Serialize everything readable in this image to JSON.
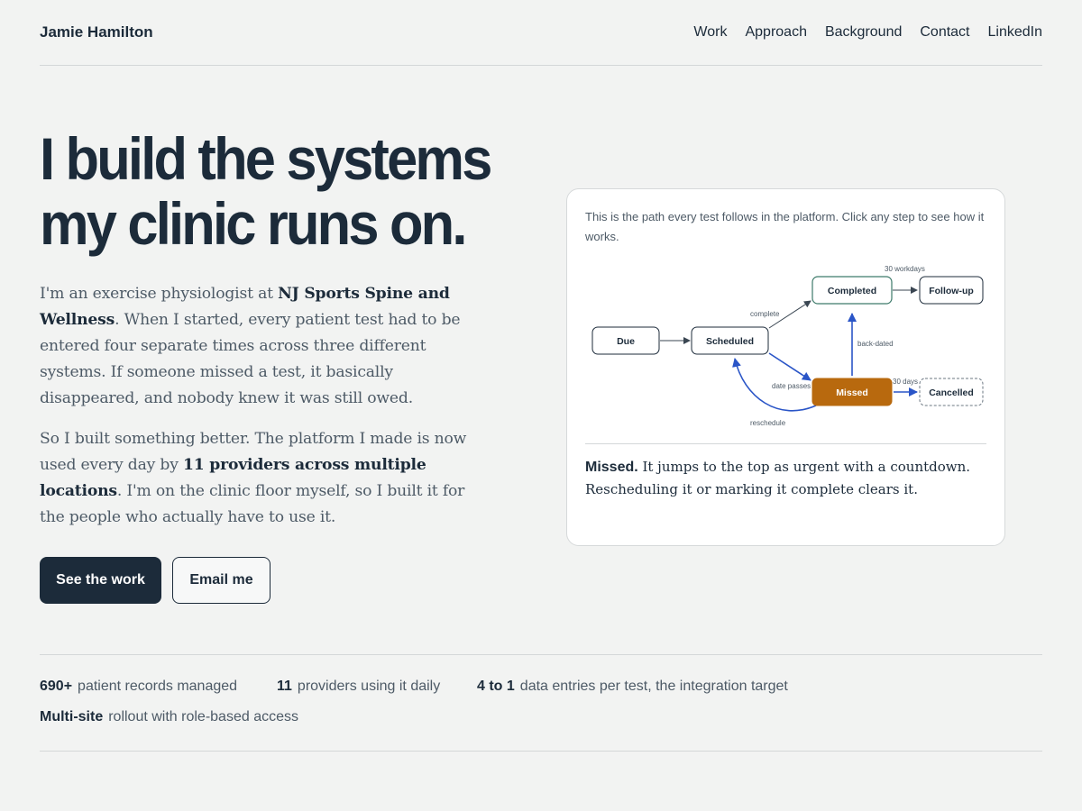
{
  "header": {
    "brand": "Jamie Hamilton",
    "nav": [
      "Work",
      "Approach",
      "Background",
      "Contact",
      "LinkedIn"
    ]
  },
  "hero": {
    "headline_line1": "I build the systems",
    "headline_line2": "my clinic runs on.",
    "p1_a": "I'm an exercise physiologist at ",
    "p1_strong": "NJ Sports Spine and Wellness",
    "p1_b": ". When I started, every patient test had to be entered four separate times across three different systems. If someone missed a test, it basically disappeared, and nobody knew it was still owed.",
    "p2_a": "So I built something better. The platform I made is now used every day by ",
    "p2_strong": "11 providers across multiple locations",
    "p2_b": ". I'm on the clinic floor myself, so I built it for the people who actually have to use it.",
    "primary_button": "See the work",
    "secondary_button": "Email me"
  },
  "card": {
    "intro": "This is the path every test follows in the platform. Click any step to see how it works.",
    "nodes": {
      "due": "Due",
      "scheduled": "Scheduled",
      "completed": "Completed",
      "followup": "Follow-up",
      "missed": "Missed",
      "cancelled": "Cancelled"
    },
    "edge_labels": {
      "complete": "complete",
      "workdays": "30 workdays",
      "back_dated": "back-dated",
      "date_passes": "date passes",
      "days": "30 days",
      "reschedule": "reschedule"
    },
    "desc_strong": "Missed.",
    "desc_text": " It jumps to the top as urgent with a countdown. Rescheduling it or marking it complete clears it."
  },
  "colors": {
    "ink": "#1c2b3a",
    "accent_blue": "#2a55c7",
    "missed_orange": "#b8690e",
    "completed_green": "#3d7a6a"
  },
  "stats": [
    {
      "value": "690+",
      "label": "patient records managed"
    },
    {
      "value": "11",
      "label": "providers using it daily"
    },
    {
      "value": "4 to 1",
      "label": "data entries per test, the integration target"
    },
    {
      "value": "Multi-site",
      "label": "rollout with role-based access"
    }
  ]
}
